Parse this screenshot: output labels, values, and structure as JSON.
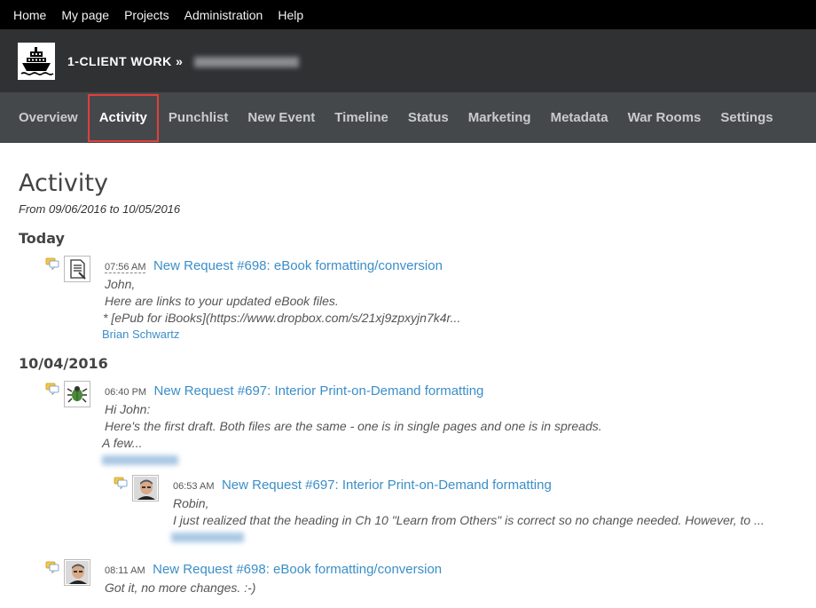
{
  "topnav": [
    "Home",
    "My page",
    "Projects",
    "Administration",
    "Help"
  ],
  "header": {
    "project_label": "1-CLIENT WORK »"
  },
  "menu": [
    "Overview",
    "Activity",
    "Punchlist",
    "New Event",
    "Timeline",
    "Status",
    "Marketing",
    "Metadata",
    "War Rooms",
    "Settings"
  ],
  "selected_tab": "Activity",
  "page": {
    "title": "Activity",
    "date_range": "From 09/06/2016 to 10/05/2016"
  },
  "groups": [
    {
      "day": "Today",
      "items": [
        {
          "time": "07:56 AM",
          "title": "New Request #698: eBook formatting/conversion",
          "lines": [
            "John,",
            "Here are links to your updated eBook files."
          ],
          "outdent_line": "* [ePub for iBooks](https://www.dropbox.com/s/21xj9zpxyjn7k4r...",
          "author": "Brian Schwartz"
        }
      ]
    },
    {
      "day": "10/04/2016",
      "items": [
        {
          "time": "06:40 PM",
          "title": "New Request #697: Interior Print-on-Demand formatting",
          "lines": [
            "Hi John:",
            "Here's the first draft. Both files are the same - one is in single pages and one is in spreads."
          ],
          "outdent_line": "A few..."
        },
        {
          "time": "06:53 AM",
          "title": "New Request #697: Interior Print-on-Demand formatting",
          "lines": [
            "Robin,",
            "I just realized that the heading in Ch 10 \"Learn from Others\" is correct so no change needed. However, to ..."
          ]
        },
        {
          "time": "08:11 AM",
          "title": "New Request #698: eBook formatting/conversion",
          "lines": [
            "Got it, no more changes. :-)"
          ]
        }
      ]
    }
  ],
  "colors": {
    "topbar": "#000000",
    "header": "#2f3133",
    "menu": "#45484b",
    "link": "#3b8ec9",
    "selected_border": "#e0403c"
  }
}
